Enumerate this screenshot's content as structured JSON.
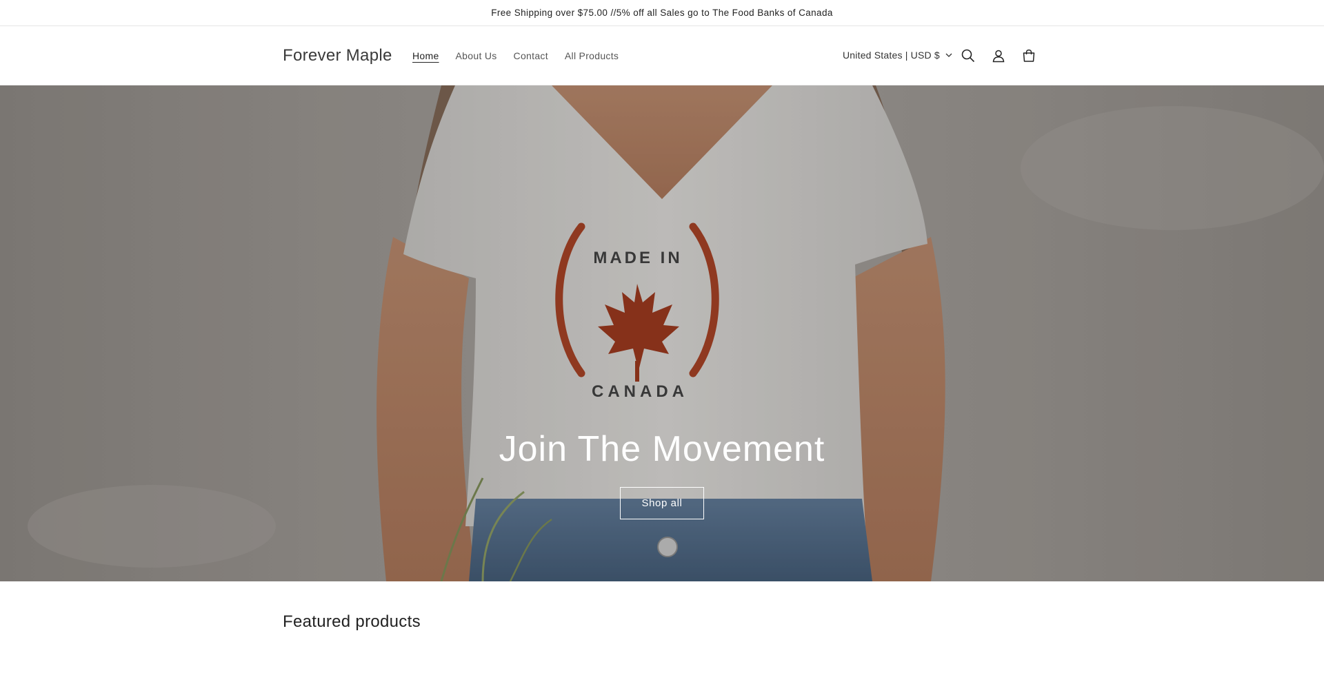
{
  "announcement": {
    "text": "Free Shipping over $75.00 //5% off all Sales go to The Food Banks of Canada"
  },
  "header": {
    "logo": "Forever Maple",
    "nav": [
      {
        "label": "Home",
        "active": true
      },
      {
        "label": "About Us",
        "active": false
      },
      {
        "label": "Contact",
        "active": false
      },
      {
        "label": "All Products",
        "active": false
      }
    ],
    "locale": "United States | USD $",
    "icons": [
      "search-icon",
      "account-icon",
      "cart-icon"
    ]
  },
  "hero": {
    "title": "Join The Movement",
    "button_label": "Shop all",
    "shirt_print": {
      "top_text": "MADE IN",
      "bottom_text": "CANADA",
      "accent_color": "#a63d1f"
    }
  },
  "featured": {
    "title": "Featured products"
  }
}
